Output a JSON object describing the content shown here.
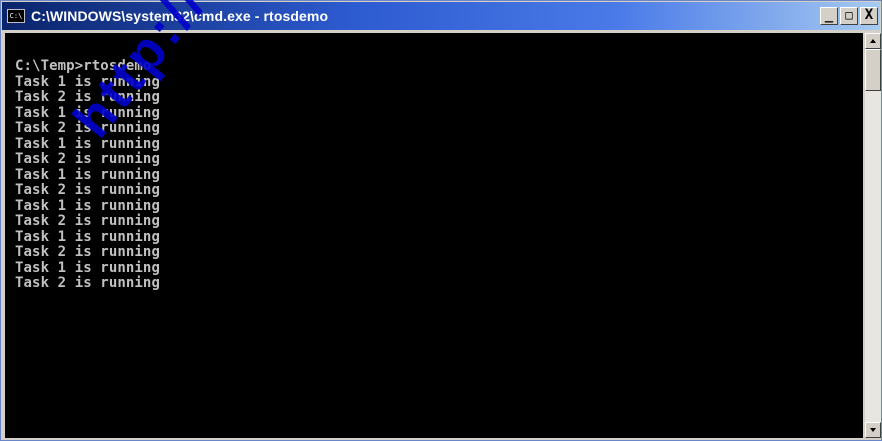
{
  "window": {
    "title": "C:\\WINDOWS\\system32\\cmd.exe - rtosdemo",
    "icon_label": "C:\\",
    "buttons": {
      "minimize": "_",
      "maximize": "□",
      "close": "X"
    }
  },
  "console": {
    "lines": [
      "C:\\Temp>rtosdemo",
      "Task 1 is running",
      "Task 2 is running",
      "Task 1 is running",
      "Task 2 is running",
      "Task 1 is running",
      "Task 2 is running",
      "Task 1 is running",
      "Task 2 is running",
      "Task 1 is running",
      "Task 2 is running",
      "Task 1 is running",
      "Task 2 is running",
      "Task 1 is running",
      "Task 2 is running"
    ]
  },
  "watermark": {
    "text": "http://www"
  },
  "colors": {
    "title_gradient_start": "#0a246a",
    "title_gradient_end": "#a6caf0",
    "console_bg": "#000000",
    "console_fg": "#c0c0c0",
    "watermark": "#0000cc"
  },
  "icons": [
    "cmd-icon",
    "minimize-icon",
    "maximize-icon",
    "close-icon",
    "scroll-up-arrow-icon",
    "scroll-down-arrow-icon"
  ]
}
